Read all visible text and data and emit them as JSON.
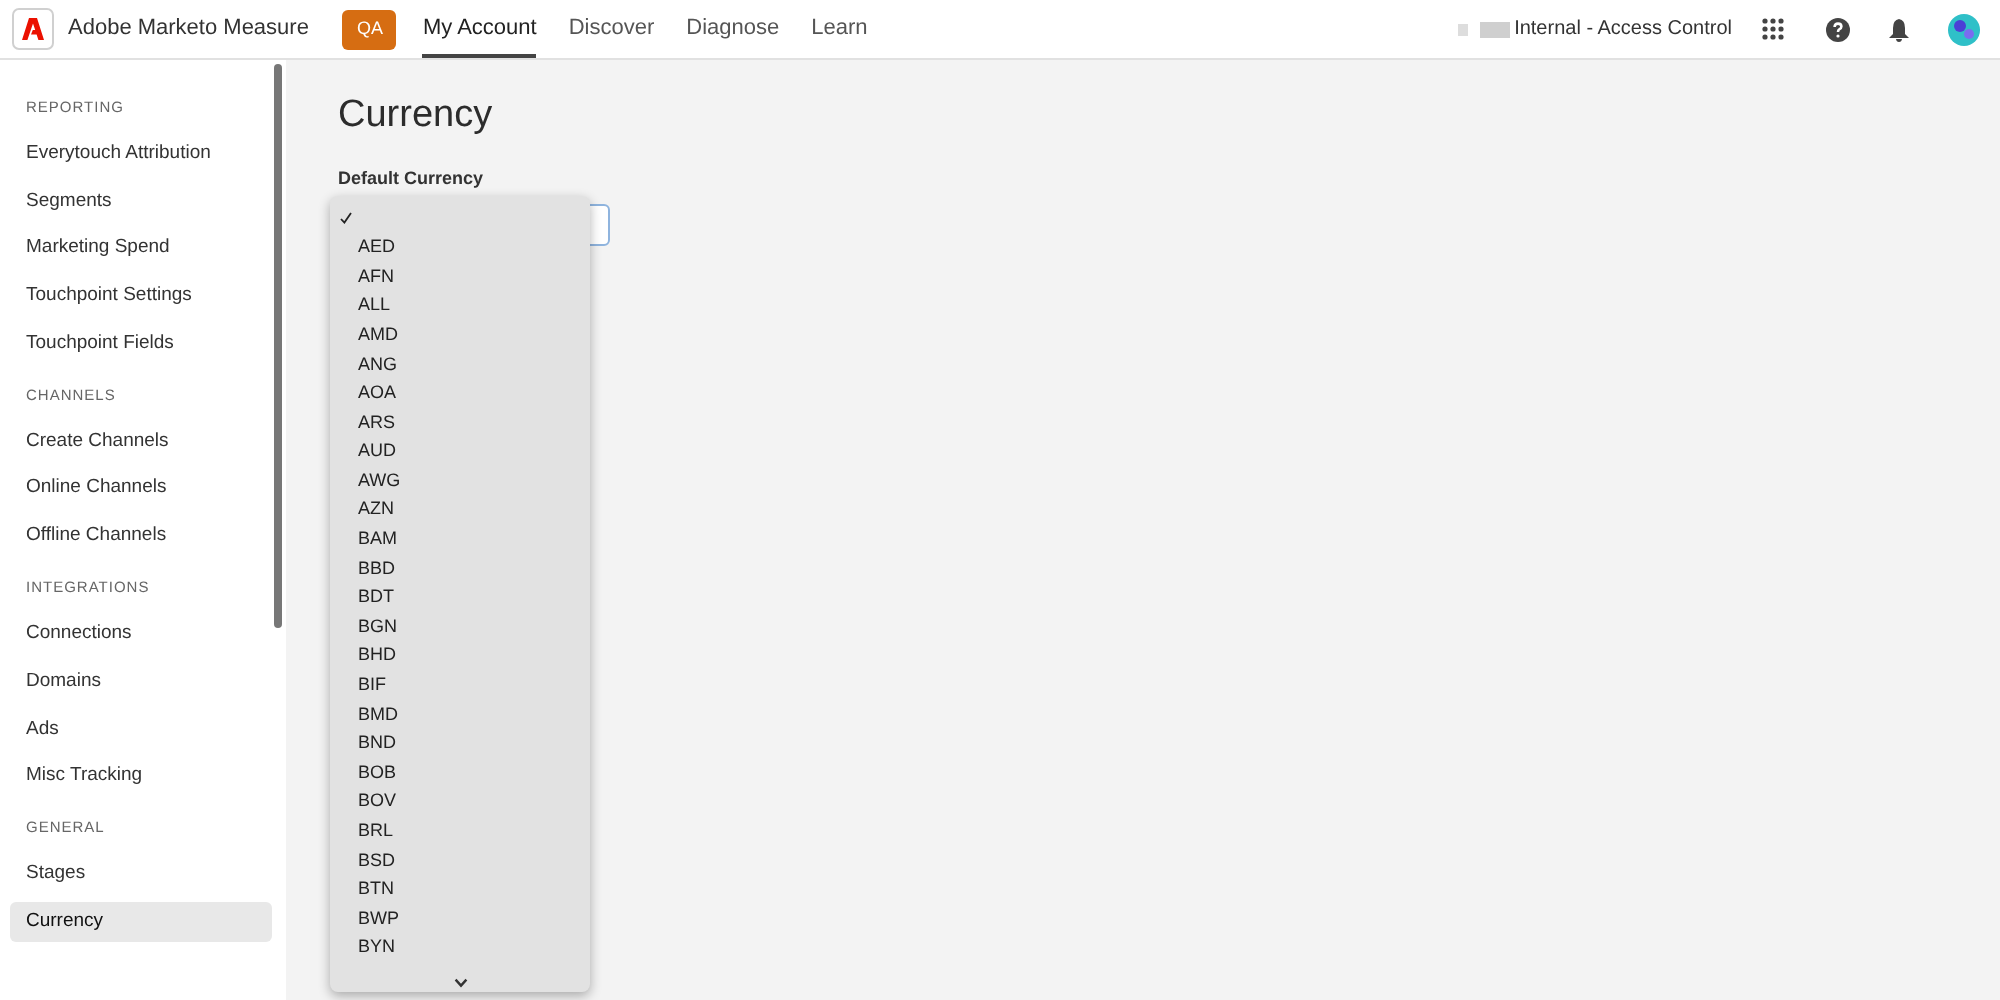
{
  "header": {
    "app_name": "Adobe Marketo Measure",
    "env_badge": "QA",
    "tabs": [
      {
        "label": "My Account",
        "selected": true
      },
      {
        "label": "Discover",
        "selected": false
      },
      {
        "label": "Diagnose",
        "selected": false
      },
      {
        "label": "Learn",
        "selected": false
      }
    ],
    "account": "Internal - Access Control"
  },
  "sidebar": {
    "sections": [
      {
        "title": "REPORTING",
        "items": [
          {
            "label": "Everytouch Attribution",
            "selected": false
          },
          {
            "label": "Segments",
            "selected": false
          },
          {
            "label": "Marketing Spend",
            "selected": false
          },
          {
            "label": "Touchpoint Settings",
            "selected": false
          },
          {
            "label": "Touchpoint Fields",
            "selected": false
          }
        ]
      },
      {
        "title": "CHANNELS",
        "items": [
          {
            "label": "Create Channels",
            "selected": false
          },
          {
            "label": "Online Channels",
            "selected": false
          },
          {
            "label": "Offline Channels",
            "selected": false
          }
        ]
      },
      {
        "title": "INTEGRATIONS",
        "items": [
          {
            "label": "Connections",
            "selected": false
          },
          {
            "label": "Domains",
            "selected": false
          },
          {
            "label": "Ads",
            "selected": false
          },
          {
            "label": "Misc Tracking",
            "selected": false
          }
        ]
      },
      {
        "title": "GENERAL",
        "items": [
          {
            "label": "Stages",
            "selected": false
          },
          {
            "label": "Currency",
            "selected": true
          }
        ]
      }
    ]
  },
  "page": {
    "title": "Currency",
    "field_label": "Default Currency",
    "options": [
      {
        "selected": true
      },
      {
        "label": "AED",
        "selected": false
      },
      {
        "label": "AFN",
        "selected": false
      },
      {
        "label": "ALL",
        "selected": false
      },
      {
        "label": "AMD",
        "selected": false
      },
      {
        "label": "ANG",
        "selected": false
      },
      {
        "label": "AOA",
        "selected": false
      },
      {
        "label": "ARS",
        "selected": false
      },
      {
        "label": "AUD",
        "selected": false
      },
      {
        "label": "AWG",
        "selected": false
      },
      {
        "label": "AZN",
        "selected": false
      },
      {
        "label": "BAM",
        "selected": false
      },
      {
        "label": "BBD",
        "selected": false
      },
      {
        "label": "BDT",
        "selected": false
      },
      {
        "label": "BGN",
        "selected": false
      },
      {
        "label": "BHD",
        "selected": false
      },
      {
        "label": "BIF",
        "selected": false
      },
      {
        "label": "BMD",
        "selected": false
      },
      {
        "label": "BND",
        "selected": false
      },
      {
        "label": "BOB",
        "selected": false
      },
      {
        "label": "BOV",
        "selected": false
      },
      {
        "label": "BRL",
        "selected": false
      },
      {
        "label": "BSD",
        "selected": false
      },
      {
        "label": "BTN",
        "selected": false
      },
      {
        "label": "BWP",
        "selected": false
      },
      {
        "label": "BYN",
        "selected": false
      }
    ]
  }
}
